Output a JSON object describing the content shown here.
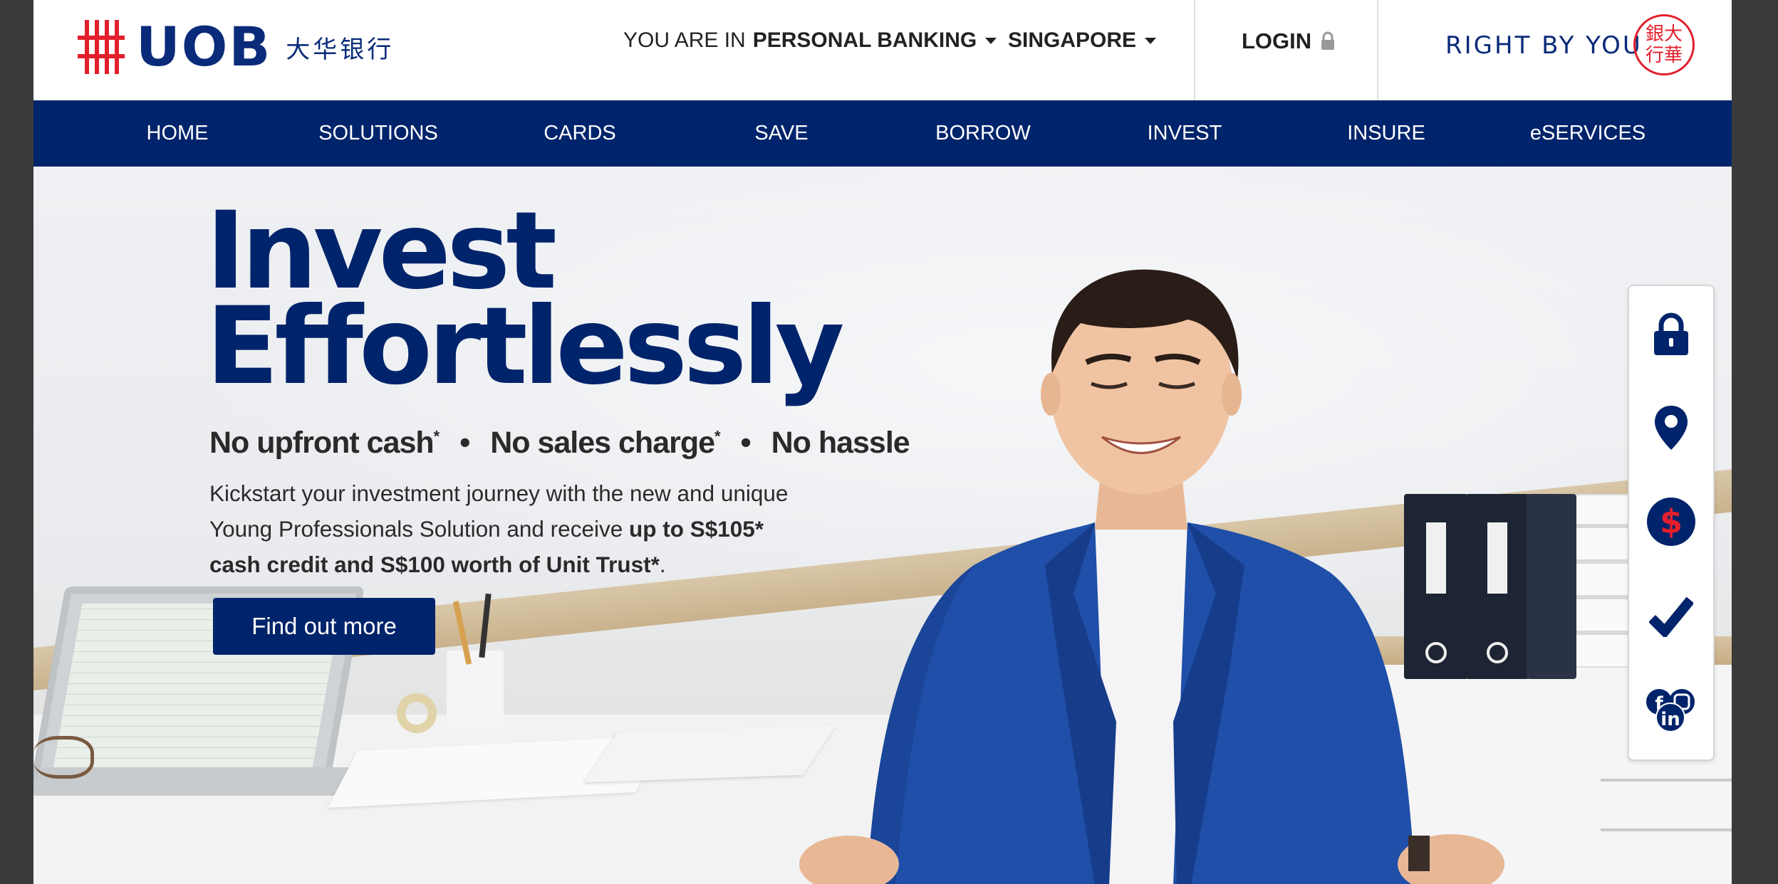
{
  "brand": {
    "logo_text": "UOB",
    "logo_chinese": "大华银行",
    "tagline": "RIGHT BY YOU",
    "seal_chars": "銀大 行華",
    "colors": {
      "navy": "#00246b",
      "red": "#e2202c"
    }
  },
  "topbar": {
    "segment_prefix": "YOU ARE IN",
    "segment_value": "PERSONAL BANKING",
    "country": "SINGAPORE",
    "login_label": "LOGIN"
  },
  "nav": {
    "items": [
      "HOME",
      "SOLUTIONS",
      "CARDS",
      "SAVE",
      "BORROW",
      "INVEST",
      "INSURE",
      "eSERVICES"
    ]
  },
  "hero": {
    "headline_line1": "Invest",
    "headline_line2": "Effortlessly",
    "sub_1": "No upfront cash",
    "sub_2": "No sales charge",
    "sub_3": "No hassle",
    "sub_mark": "*",
    "sub_sep": "•",
    "body_line1": "Kickstart your investment journey with the new and unique",
    "body_line2_plain": "Young Professionals Solution and receive ",
    "body_line2_bold": "up to S$105*",
    "body_line3_bold": "cash credit and S$100 worth of Unit Trust*",
    "body_line3_end": ".",
    "cta_label": "Find out more"
  },
  "side_toolbar": {
    "icons": [
      "lock-icon",
      "location-pin-icon",
      "dollar-icon",
      "tick-icon",
      "social-icon"
    ]
  }
}
